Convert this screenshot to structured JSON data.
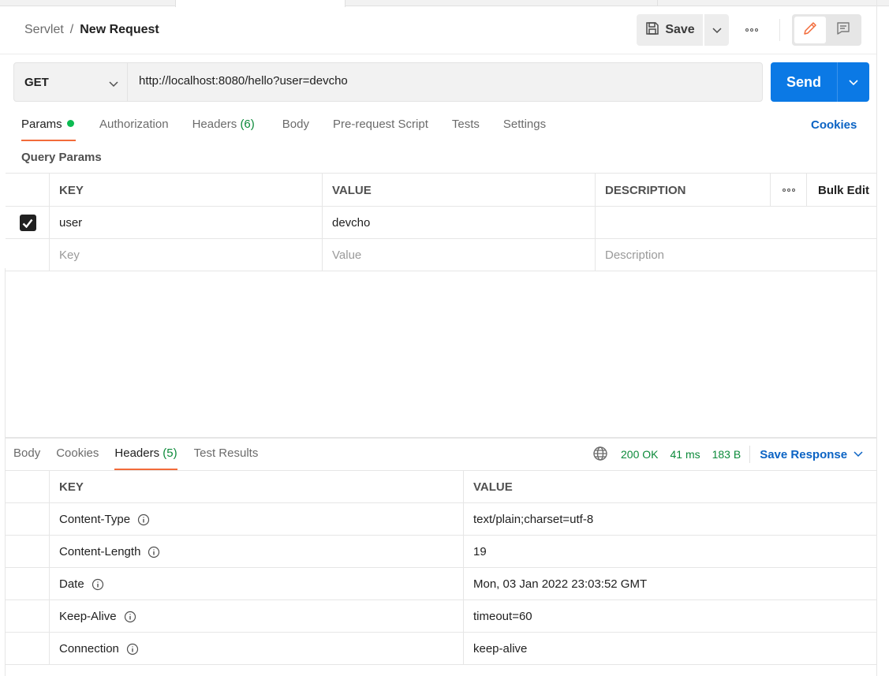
{
  "header": {
    "breadcrumb_parent": "Servlet",
    "breadcrumb_sep": "/",
    "breadcrumb_current": "New Request",
    "save_label": "Save"
  },
  "request": {
    "method": "GET",
    "url": "http://localhost:8080/hello?user=devcho",
    "send_label": "Send"
  },
  "request_tabs": [
    {
      "label": "Params",
      "dot": true
    },
    {
      "label": "Authorization"
    },
    {
      "label": "Headers",
      "count": "(6)"
    },
    {
      "label": "Body"
    },
    {
      "label": "Pre-request Script"
    },
    {
      "label": "Tests"
    },
    {
      "label": "Settings"
    }
  ],
  "cookies_link": "Cookies",
  "query_params": {
    "title": "Query Params",
    "columns": {
      "key": "KEY",
      "value": "VALUE",
      "description": "DESCRIPTION",
      "bulk_edit": "Bulk Edit"
    },
    "rows": [
      {
        "checked": true,
        "key": "user",
        "value": "devcho",
        "description": ""
      }
    ],
    "placeholders": {
      "key": "Key",
      "value": "Value",
      "description": "Description"
    }
  },
  "response_tabs": [
    {
      "label": "Body"
    },
    {
      "label": "Cookies"
    },
    {
      "label": "Headers",
      "count": "(5)"
    },
    {
      "label": "Test Results"
    }
  ],
  "response_status": {
    "status": "200 OK",
    "time": "41 ms",
    "size": "183 B",
    "save_response": "Save Response"
  },
  "response_headers": {
    "columns": {
      "key": "KEY",
      "value": "VALUE"
    },
    "rows": [
      {
        "key": "Content-Type",
        "value": "text/plain;charset=utf-8"
      },
      {
        "key": "Content-Length",
        "value": "19"
      },
      {
        "key": "Date",
        "value": "Mon, 03 Jan 2022 23:03:52 GMT"
      },
      {
        "key": "Keep-Alive",
        "value": "timeout=60"
      },
      {
        "key": "Connection",
        "value": "keep-alive"
      }
    ]
  },
  "colors": {
    "accent": "#0b79e5",
    "active_tab_underline": "#f26b3a",
    "success": "#0c8a3a",
    "link": "#0b63c4"
  },
  "icons": [
    "save-icon",
    "chevron-down-icon",
    "more-icon",
    "pencil-icon",
    "comment-icon",
    "globe-icon",
    "info-icon",
    "checkmark-icon"
  ]
}
